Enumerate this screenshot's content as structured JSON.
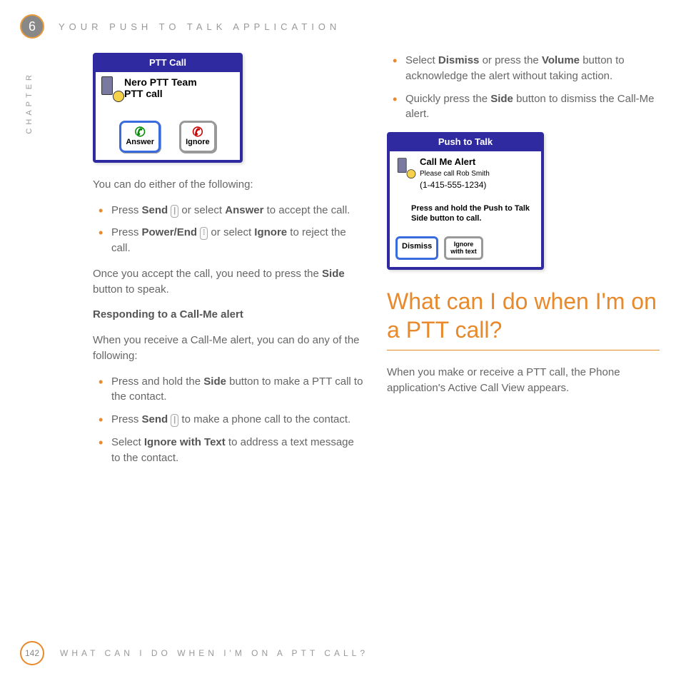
{
  "header": {
    "chapter_num": "6",
    "title": "YOUR PUSH TO TALK APPLICATION",
    "side_label": "CHAPTER"
  },
  "mockup1": {
    "title": "PTT Call",
    "line1": "Nero PTT Team",
    "line2": "PTT call",
    "btn_answer": "Answer",
    "btn_ignore": "Ignore"
  },
  "left": {
    "p1": "You can do either of the following:",
    "b1_pre": "Press ",
    "b1_bold": "Send",
    "b1_mid": " or select ",
    "b1_bold2": "Answer",
    "b1_post": " to accept the call.",
    "b2_pre": "Press ",
    "b2_bold": "Power/End",
    "b2_mid": " or select ",
    "b2_bold2": "Ignore",
    "b2_post": " to reject the call.",
    "p2_pre": "Once you accept the call, you need to press the ",
    "p2_bold": "Side",
    "p2_post": " button to speak.",
    "sub": "Responding to a Call-Me alert",
    "p3": "When you receive a Call-Me alert, you can do any of the following:",
    "c1_pre": "Press and hold the ",
    "c1_bold": "Side",
    "c1_post": " button to make a PTT call to the contact.",
    "c2_pre": "Press ",
    "c2_bold": "Send",
    "c2_post": " to make a phone call to the contact.",
    "c3_pre": "Select ",
    "c3_bold": "Ignore with Text",
    "c3_post": " to address a text message to the contact."
  },
  "right": {
    "d1_pre": "Select ",
    "d1_bold": "Dismiss",
    "d1_mid": " or press the ",
    "d1_bold2": "Volume",
    "d1_post": " button to acknowledge the alert without taking action.",
    "d2_pre": "Quickly press the ",
    "d2_bold": "Side",
    "d2_post": " button to dismiss the Call-Me alert."
  },
  "mockup2": {
    "title": "Push to Talk",
    "h1": "Call Me Alert",
    "h2": "Please call Rob Smith",
    "h3": "(1-415-555-1234)",
    "msg": "Press and hold the Push to Talk Side button to call.",
    "btn_dismiss": "Dismiss",
    "btn_ignore1": "Ignore",
    "btn_ignore2": "with text"
  },
  "section": {
    "title": "What can I do when I'm on a PTT call?",
    "body": "When you make or receive a PTT call, the Phone application's Active Call View appears."
  },
  "footer": {
    "page": "142",
    "text": "WHAT CAN I DO WHEN I'M ON A PTT CALL?"
  }
}
